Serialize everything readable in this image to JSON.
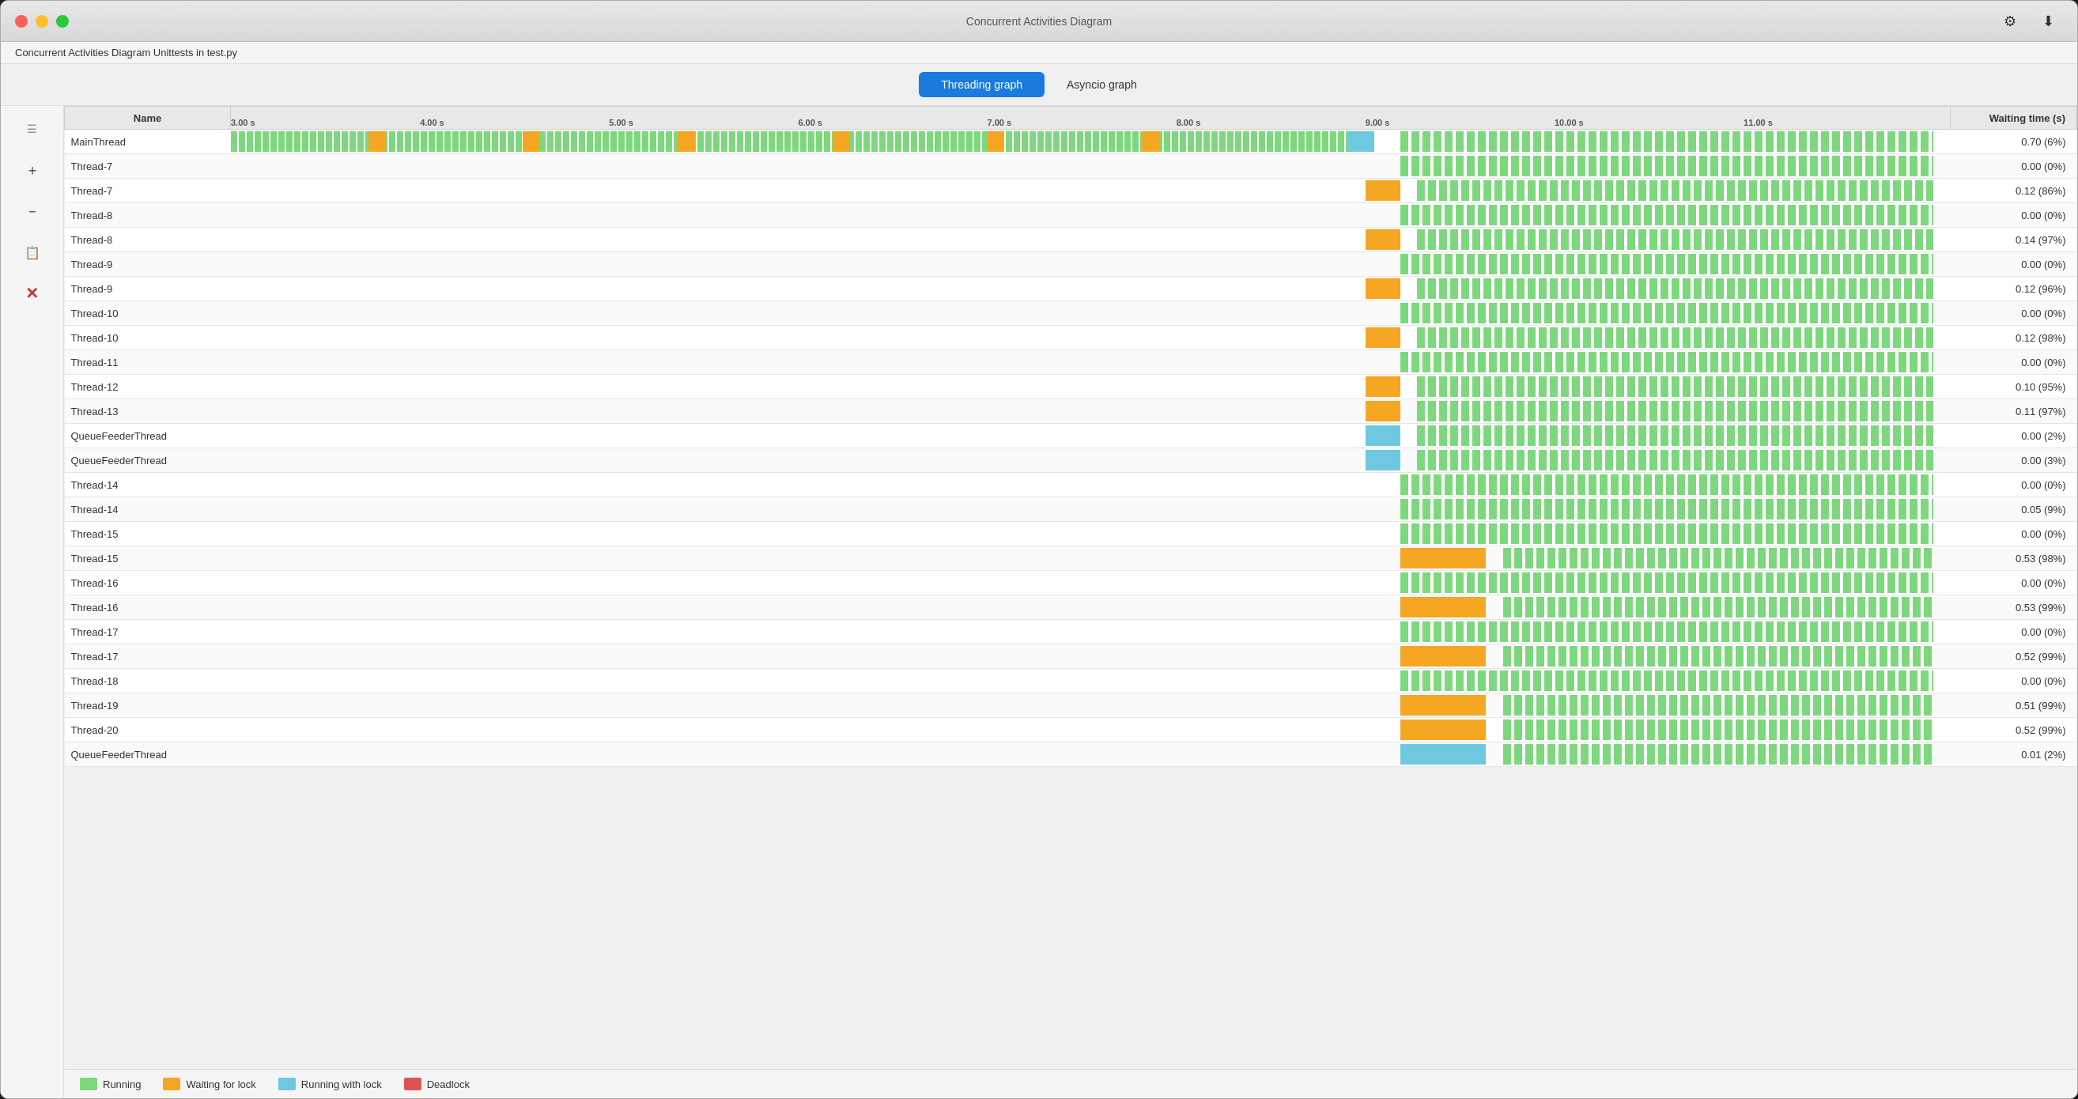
{
  "window": {
    "title": "Concurrent Activities Diagram",
    "subtitle": "Concurrent Activities Diagram Unittests in test.py"
  },
  "tabs": [
    {
      "id": "threading",
      "label": "Threading graph",
      "active": true
    },
    {
      "id": "asyncio",
      "label": "Asyncio graph",
      "active": false
    }
  ],
  "toolbar": {
    "settings_icon": "⚙",
    "download_icon": "⬇",
    "zoom_in_icon": "🔍",
    "zoom_out_icon": "🔍",
    "copy_icon": "📋",
    "close_icon": "✕"
  },
  "table": {
    "headers": [
      "Name",
      "",
      "Waiting time (s)"
    ],
    "rows": [
      {
        "name": "MainThread",
        "wait": "0.70 (6%)",
        "mainGreen": true
      },
      {
        "name": "Thread-7",
        "wait": "0.00 (0%)",
        "rightOnly": true
      },
      {
        "name": "Thread-7",
        "wait": "0.12 (86%)",
        "rightOnlyOrange": true
      },
      {
        "name": "Thread-8",
        "wait": "0.00 (0%)",
        "rightOnly": true
      },
      {
        "name": "Thread-8",
        "wait": "0.14 (97%)",
        "rightOnlyOrange": true
      },
      {
        "name": "Thread-9",
        "wait": "0.00 (0%)",
        "rightOnly": true
      },
      {
        "name": "Thread-9",
        "wait": "0.12 (96%)",
        "rightOnlyOrange": true
      },
      {
        "name": "Thread-10",
        "wait": "0.00 (0%)",
        "rightOnly": true
      },
      {
        "name": "Thread-10",
        "wait": "0.12 (98%)",
        "rightOnlyOrange": true
      },
      {
        "name": "Thread-11",
        "wait": "0.00 (0%)",
        "rightOnly": true
      },
      {
        "name": "Thread-12",
        "wait": "0.10 (95%)",
        "rightOnlyOrange": true
      },
      {
        "name": "Thread-13",
        "wait": "0.11 (97%)",
        "rightOnlyOrange": true
      },
      {
        "name": "QueueFeederThread",
        "wait": "0.00 (2%)",
        "rightOnlyBlue": true
      },
      {
        "name": "QueueFeederThread",
        "wait": "0.00 (3%)",
        "rightOnlyBlue": true
      },
      {
        "name": "Thread-14",
        "wait": "0.00 (0%)",
        "rightOnly": true
      },
      {
        "name": "Thread-14",
        "wait": "0.05 (9%)",
        "rightOnly": true
      },
      {
        "name": "Thread-15",
        "wait": "0.00 (0%)",
        "rightOnly": true
      },
      {
        "name": "Thread-15",
        "wait": "0.53 (98%)",
        "rightOnlyBigOrange": true
      },
      {
        "name": "Thread-16",
        "wait": "0.00 (0%)",
        "rightOnly": true
      },
      {
        "name": "Thread-16",
        "wait": "0.53 (99%)",
        "rightOnlyBigOrange": true
      },
      {
        "name": "Thread-17",
        "wait": "0.00 (0%)",
        "rightOnly": true
      },
      {
        "name": "Thread-17",
        "wait": "0.52 (99%)",
        "rightOnlyBigOrange": true
      },
      {
        "name": "Thread-18",
        "wait": "0.00 (0%)",
        "rightOnly": true
      },
      {
        "name": "Thread-19",
        "wait": "0.51 (99%)",
        "rightOnlyBigOrange": true
      },
      {
        "name": "Thread-20",
        "wait": "0.52 (99%)",
        "rightOnlyBigOrange": true
      },
      {
        "name": "QueueFeederThread",
        "wait": "0.01 (2%)",
        "rightOnlyBlue": true
      }
    ]
  },
  "legend": [
    {
      "label": "Running",
      "color": "#7dd87d"
    },
    {
      "label": "Waiting for lock",
      "color": "#f5a623"
    },
    {
      "label": "Running with lock",
      "color": "#6ec8e0"
    },
    {
      "label": "Deadlock",
      "color": "#e05252"
    }
  ],
  "colors": {
    "running": "#7dd87d",
    "waiting": "#f5a623",
    "running_with_lock": "#6ec8e0",
    "deadlock": "#e05252",
    "tab_active_bg": "#1a7bdc",
    "tab_active_text": "#ffffff"
  }
}
